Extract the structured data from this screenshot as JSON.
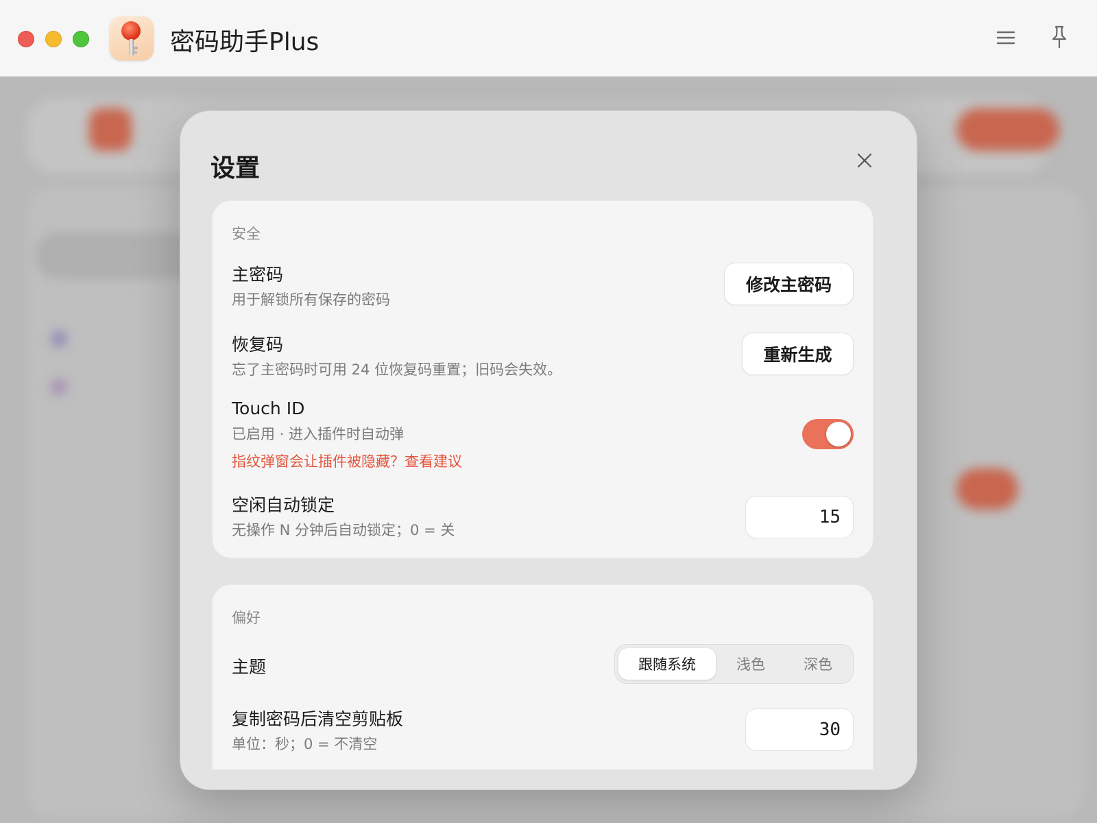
{
  "window": {
    "title": "密码助手Plus",
    "icons": {
      "menu": "menu-icon",
      "pin": "pin-icon",
      "app": "key-icon"
    }
  },
  "dialog": {
    "title": "设置",
    "security": {
      "section_label": "安全",
      "master_password": {
        "title": "主密码",
        "description": "用于解锁所有保存的密码",
        "button_label": "修改主密码"
      },
      "recovery_code": {
        "title": "恢复码",
        "description": "忘了主密码时可用 24 位恢复码重置；旧码会失效。",
        "button_label": "重新生成"
      },
      "touch_id": {
        "title": "Touch ID",
        "description": "已启用 · 进入插件时自动弹",
        "link": "指纹弹窗会让插件被隐藏？查看建议",
        "enabled": true
      },
      "idle_lock": {
        "title": "空闲自动锁定",
        "description": "无操作 N 分钟后自动锁定；0 = 关",
        "value": "15"
      }
    },
    "preferences": {
      "section_label": "偏好",
      "theme": {
        "title": "主题",
        "options": [
          "跟随系统",
          "浅色",
          "深色"
        ],
        "selected": "跟随系统"
      },
      "clipboard": {
        "title": "复制密码后清空剪贴板",
        "description": "单位：秒；0 = 不清空",
        "value": "30"
      }
    }
  },
  "colors": {
    "accent": "#ea715a",
    "link": "#e4553b",
    "traffic_red": "#ee5d55",
    "traffic_yellow": "#f5bc2f",
    "traffic_green": "#4fc53c"
  }
}
